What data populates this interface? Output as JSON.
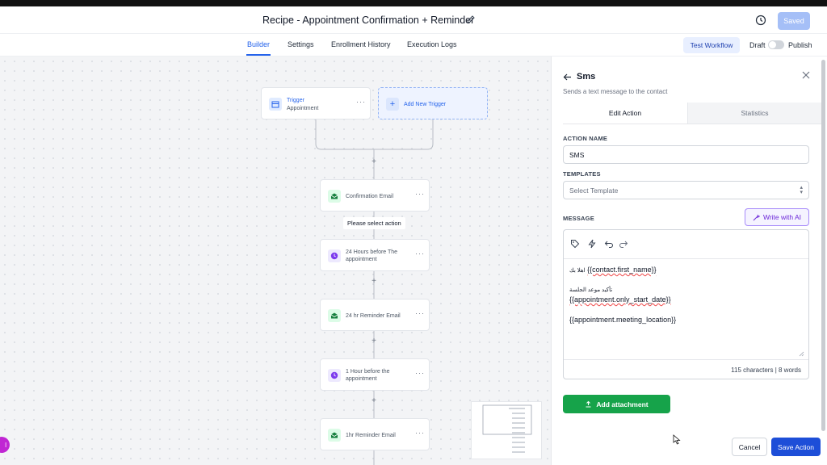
{
  "header": {
    "title": "Recipe - Appointment Confirmation + Reminder",
    "saved_label": "Saved"
  },
  "nav": {
    "tabs": [
      "Builder",
      "Settings",
      "Enrollment History",
      "Execution Logs"
    ],
    "active_tab": "Builder",
    "test_workflow_label": "Test Workflow",
    "draft_label": "Draft",
    "publish_label": "Publish"
  },
  "canvas": {
    "trigger": {
      "title": "Trigger",
      "subtitle": "Appointment"
    },
    "add_trigger_label": "Add New Trigger",
    "tooltip": "Please select action",
    "steps": [
      {
        "label": "Confirmation Email",
        "icon": "email-icon"
      },
      {
        "label": "24 Hours before The appointment",
        "icon": "clock-icon"
      },
      {
        "label": "24 hr Reminder Email",
        "icon": "email-icon"
      },
      {
        "label": "1 Hour before the appointment",
        "icon": "clock-icon"
      },
      {
        "label": "1hr Reminder Email",
        "icon": "email-icon"
      }
    ],
    "avatar_text": "l"
  },
  "panel": {
    "title": "Sms",
    "subtitle": "Sends a text message to the contact",
    "tabs": [
      "Edit Action",
      "Statistics"
    ],
    "active_tab": "Edit Action",
    "action_name_label": "ACTION NAME",
    "action_name_value": "SMS",
    "templates_label": "TEMPLATES",
    "templates_placeholder": "Select Template",
    "message_label": "MESSAGE",
    "write_ai_label": "Write with AI",
    "message": {
      "line1_arabic": "اهلا بك",
      "line1_var": "{{contact.first_name}}",
      "line2_arabic": "تأكيد موعد الجلسة",
      "line3_var": "{{appointment.only_start_date}}",
      "line4_var": "{{appointment.meeting_location}}"
    },
    "counter": "115 characters | 8 words",
    "add_attachment_label": "Add attachment",
    "cancel_label": "Cancel",
    "save_label": "Save Action"
  },
  "colors": {
    "primary": "#2563eb",
    "green": "#16a34a",
    "purple_ai": "#7c3aed"
  }
}
